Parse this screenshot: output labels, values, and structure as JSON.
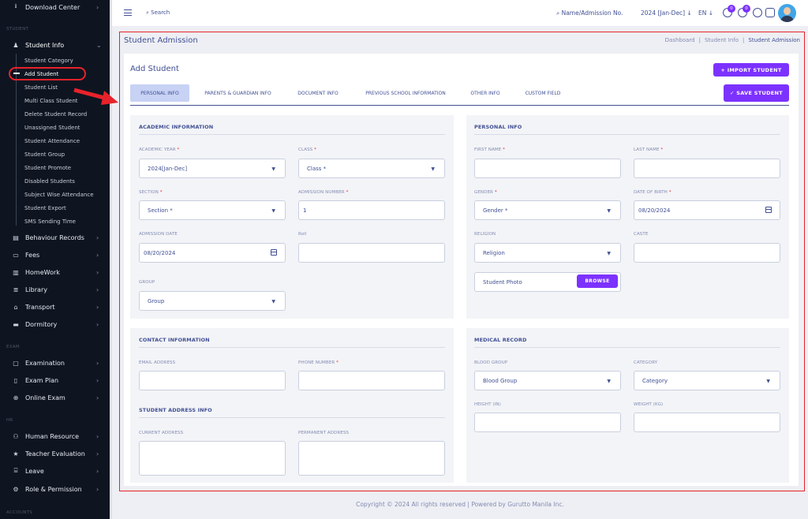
{
  "sidebar": {
    "top_item": {
      "label": "Download Center",
      "icon": "download-icon"
    },
    "section_student": "STUDENT",
    "student_info": {
      "label": "Student Info",
      "icon": "student-icon"
    },
    "sub_items": [
      "Student Category",
      "Add Student",
      "Student List",
      "Multi Class Student",
      "Delete Student Record",
      "Unassigned Student",
      "Student Attendance",
      "Student Group",
      "Student Promote",
      "Disabled Students",
      "Subject Wise Attendance",
      "Student Export",
      "SMS Sending Time"
    ],
    "items_after": [
      {
        "label": "Behaviour Records",
        "icon": "records-icon"
      },
      {
        "label": "Fees",
        "icon": "fees-icon"
      },
      {
        "label": "HomeWork",
        "icon": "book-icon"
      },
      {
        "label": "Library",
        "icon": "library-icon"
      },
      {
        "label": "Transport",
        "icon": "bus-icon"
      },
      {
        "label": "Dormitory",
        "icon": "bed-icon"
      }
    ],
    "section_exam": "EXAM",
    "exam_items": [
      {
        "label": "Examination",
        "icon": "exam-icon"
      },
      {
        "label": "Exam Plan",
        "icon": "plan-icon"
      },
      {
        "label": "Online Exam",
        "icon": "globe-icon"
      }
    ],
    "section_hr": "HR",
    "hr_items": [
      {
        "label": "Human Resource",
        "icon": "people-icon"
      },
      {
        "label": "Teacher Evaluation",
        "icon": "star-icon"
      },
      {
        "label": "Leave",
        "icon": "leave-icon"
      },
      {
        "label": "Role & Permission",
        "icon": "gear-icon"
      }
    ],
    "section_accounts": "ACCOUNTS"
  },
  "topbar": {
    "search": "Search",
    "name_search": "Name/Admission No.",
    "session": "2024 [Jan-Dec]",
    "lang": "EN",
    "badge1": "0",
    "badge2": "0"
  },
  "page": {
    "title": "Student Admission",
    "crumbs": [
      "Dashboard",
      "Student Info",
      "Student Admission"
    ],
    "subtitle": "Add Student",
    "import_btn": "+ IMPORT STUDENT",
    "save_btn": "✓ SAVE STUDENT",
    "tabs": [
      "PERSONAL INFO",
      "PARENTS & GUARDIAN INFO",
      "DOCUMENT INFO",
      "PREVIOUS SCHOOL INFORMATION",
      "OTHER INFO",
      "CUSTOM FIELD"
    ]
  },
  "academic": {
    "title": "ACADEMIC INFORMATION",
    "academic_year_label": "ACADEMIC YEAR",
    "academic_year_value": "2024[Jan-Dec]",
    "class_label": "CLASS",
    "class_value": "Class *",
    "section_label": "SECTION",
    "section_value": "Section *",
    "admission_no_label": "ADMISSION NUMBER",
    "admission_no_value": "1",
    "admission_date_label": "ADMISSION DATE",
    "admission_date_value": "08/20/2024",
    "roll_label": "Roll",
    "group_label": "GROUP",
    "group_value": "Group"
  },
  "personal": {
    "title": "PERSONAL INFO",
    "first_name_label": "FIRST NAME",
    "last_name_label": "LAST NAME",
    "gender_label": "GENDER",
    "gender_value": "Gender *",
    "dob_label": "DATE OF BIRTH",
    "dob_value": "08/20/2024",
    "religion_label": "RELIGION",
    "religion_value": "Religion",
    "caste_label": "CASTE",
    "photo_label": "Student Photo",
    "browse": "BROWSE"
  },
  "contact": {
    "title": "CONTACT INFORMATION",
    "email_label": "EMAIL ADDRESS",
    "phone_label": "PHONE NUMBER",
    "address_title": "STUDENT ADDRESS INFO",
    "current_label": "CURRENT ADDRESS",
    "permanent_label": "PERMANENT ADDRESS"
  },
  "medical": {
    "title": "MEDICAL RECORD",
    "blood_label": "BLOOD GROUP",
    "blood_value": "Blood Group",
    "category_label": "CATEGORY",
    "category_value": "Category",
    "height_label": "HEIGHT (IN)",
    "weight_label": "WEIGHT (KG)"
  },
  "footer": "Copyright © 2024 All rights reserved | Powered by Gurutto Manila Inc.",
  "colors": {
    "accent": "#7c32ff",
    "sidebar": "#0e1521",
    "text": "#415094",
    "highlight": "#e8222a"
  }
}
